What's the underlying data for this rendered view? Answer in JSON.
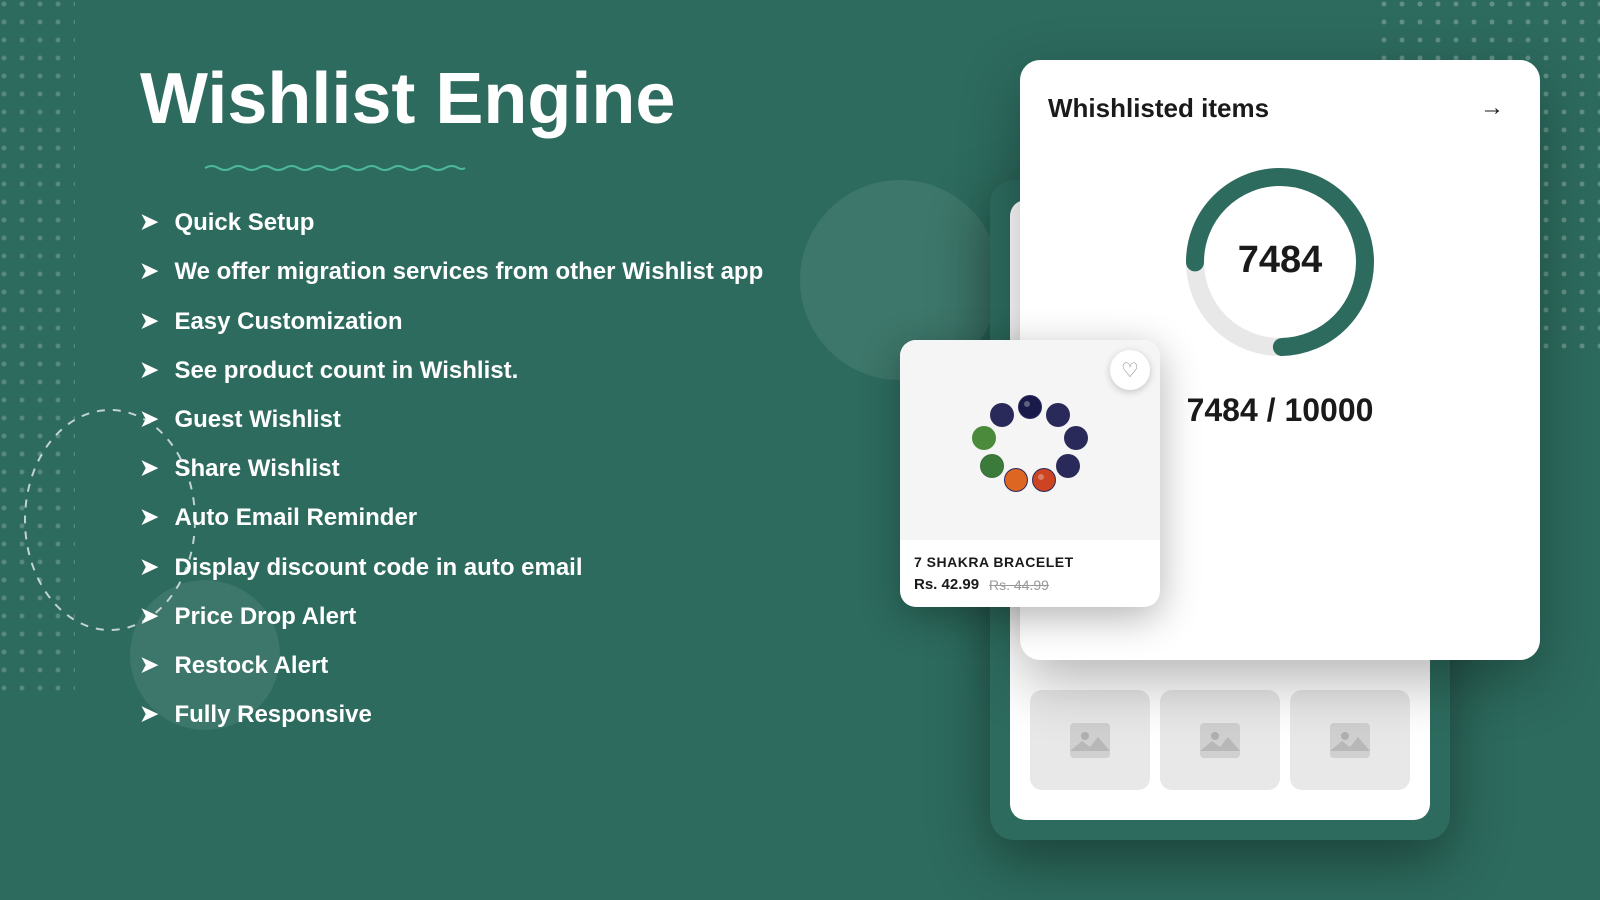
{
  "page": {
    "background_color": "#2d6b5e",
    "title": "Wishlist Engine"
  },
  "header": {
    "title": "Wishlist Engine"
  },
  "features": {
    "items": [
      {
        "id": "quick-setup",
        "text": "Quick Setup"
      },
      {
        "id": "migration",
        "text": "We offer migration services from other Wishlist app"
      },
      {
        "id": "customization",
        "text": "Easy Customization"
      },
      {
        "id": "product-count",
        "text": "See product count in Wishlist."
      },
      {
        "id": "guest-wishlist",
        "text": "Guest Wishlist"
      },
      {
        "id": "share-wishlist",
        "text": "Share Wishlist"
      },
      {
        "id": "auto-email",
        "text": "Auto Email Reminder"
      },
      {
        "id": "discount-code",
        "text": "Display discount code in auto email"
      },
      {
        "id": "price-drop",
        "text": "Price Drop Alert"
      },
      {
        "id": "restock",
        "text": "Restock Alert"
      },
      {
        "id": "responsive",
        "text": "Fully Responsive"
      }
    ],
    "arrow_symbol": "➤"
  },
  "card": {
    "title": "Whishlisted items",
    "arrow": "→",
    "donut": {
      "value": 7484,
      "max": 10000,
      "percentage": 74.84,
      "color": "#2d6b5e",
      "track_color": "#e8e8e8"
    },
    "number_display": "7484",
    "progress_display": "7484 / 10000"
  },
  "product": {
    "name": "7 SHAKRA BRACELET",
    "current_price": "Rs. 42.99",
    "original_price": "Rs. 44.99"
  },
  "icons": {
    "heart_outline": "♡",
    "heart_filled": "♥",
    "image_placeholder": "🖼"
  }
}
